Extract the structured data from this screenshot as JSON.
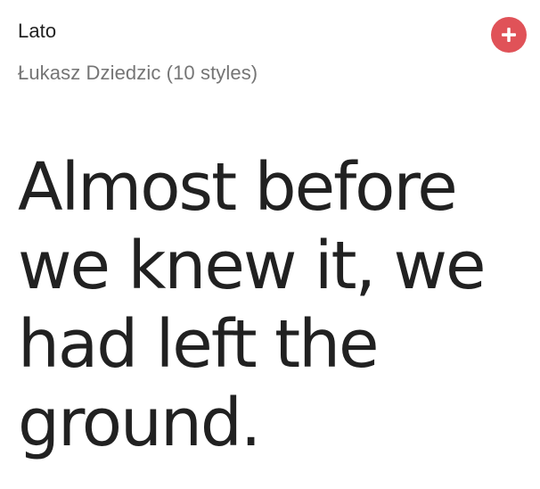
{
  "font_card": {
    "name": "Lato",
    "meta": "Łukasz Dziedzic (10 styles)",
    "add_icon": "plus-icon",
    "add_color": "#e05258",
    "preview_text": "Almost before we knew it, we had left the ground."
  }
}
